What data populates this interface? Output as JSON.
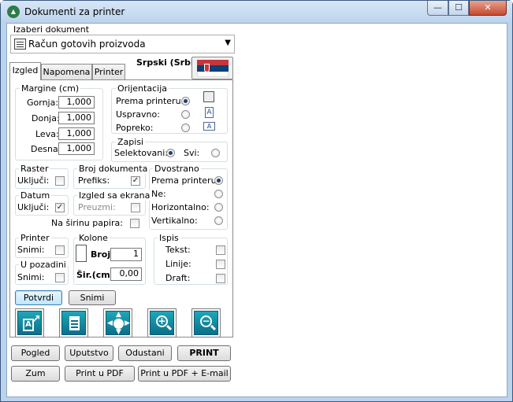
{
  "window": {
    "title": "Dokumenti za printer",
    "app_icon": "app-logo-icon",
    "controls": {
      "minimize": "—",
      "maximize": "☐",
      "close": "✕"
    }
  },
  "document": {
    "label": "Izaberi dokument",
    "selected": "Račun gotovih proizvoda"
  },
  "tabs": [
    "Izgled",
    "Napomena",
    "Printer"
  ],
  "language": "Srpski (Srbija)",
  "flag_colors": {
    "red": "#c6363c",
    "blue": "#0c4076",
    "white": "#ffffff"
  },
  "margins": {
    "title": "Margine (cm)",
    "rows": [
      {
        "label": "Gornja:",
        "value": "1,000"
      },
      {
        "label": "Donja:",
        "value": "1,000"
      },
      {
        "label": "Leva:",
        "value": "1,000"
      },
      {
        "label": "Desna:",
        "value": "1,000"
      }
    ]
  },
  "orientation": {
    "title": "Orijentacija",
    "options": [
      {
        "label": "Prema printeru:",
        "selected": true,
        "icon": "printer-icon"
      },
      {
        "label": "Uspravno:",
        "selected": false,
        "icon": "portrait-page-icon"
      },
      {
        "label": "Popreko:",
        "selected": false,
        "icon": "landscape-page-icon"
      }
    ]
  },
  "records": {
    "title": "Zapisi",
    "selected_label": "Selektovani:",
    "all_label": "Svi:"
  },
  "raster": {
    "title": "Raster",
    "label": "Uključi:"
  },
  "doc_number": {
    "title": "Broj dokumenta",
    "label": "Prefiks:",
    "checked": "✓"
  },
  "duplex": {
    "title": "Dvostrano",
    "options": [
      "Prema printeru:",
      "Ne:",
      "Horizontalno:",
      "Vertikalno:"
    ]
  },
  "date": {
    "title": "Datum",
    "label": "Uključi:",
    "checked": "✓"
  },
  "screen_look": {
    "title": "Izgled sa ekrana",
    "label": "Preuzmi:"
  },
  "paper_width": {
    "label": "Na širinu papira:"
  },
  "printer_grp": {
    "title": "Printer",
    "label": "Snimi:"
  },
  "columns": {
    "title": "Kolone",
    "count_label": "Broj:",
    "count_value": "1",
    "width_label": "Šir.(cm):",
    "width_value": "0,00"
  },
  "print_grp": {
    "title": "Ispis",
    "items": [
      "Tekst:",
      "Linije:",
      "Draft:"
    ]
  },
  "background": {
    "title": "U pozadini",
    "label": "Snimi:"
  },
  "buttons": {
    "confirm": "Potvrdi",
    "save": "Snimi",
    "preview": "Pogled",
    "manual": "Uputstvo",
    "cancel": "Odustani",
    "print": "PRINT",
    "zoom": "Zum",
    "print_pdf": "Print u PDF",
    "print_pdf_email": "Print u PDF  + E-mail"
  },
  "toolbar_icons": [
    "export-icon",
    "document-icon",
    "move-icon",
    "zoom-in-icon",
    "zoom-out-icon"
  ]
}
